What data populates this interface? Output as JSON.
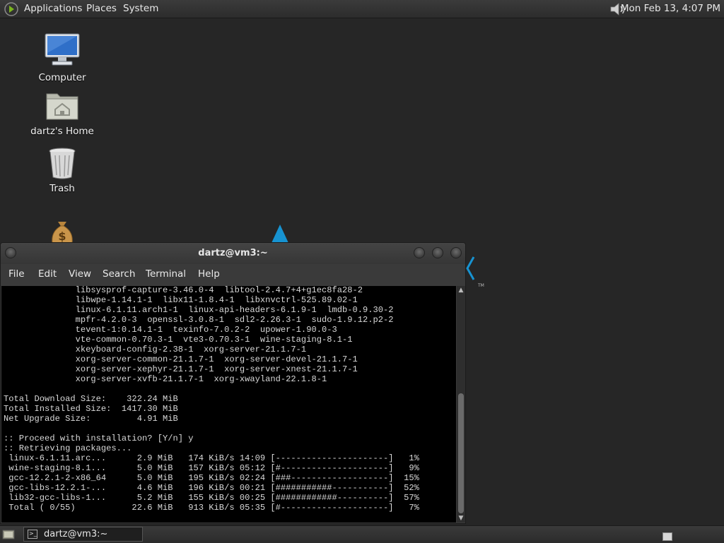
{
  "top_panel": {
    "menus": [
      "Applications",
      "Places",
      "System"
    ],
    "clock": "Mon Feb 13,  4:07 PM"
  },
  "desktop": {
    "icons": [
      {
        "label": "Computer",
        "icon": "computer-icon"
      },
      {
        "label": "dartz's Home",
        "icon": "home-folder-icon"
      },
      {
        "label": "Trash",
        "icon": "trash-icon"
      },
      {
        "label": "",
        "icon": "money-bag-icon"
      }
    ]
  },
  "terminal": {
    "title": "dartz@vm3:~",
    "menu": [
      "File",
      "Edit",
      "View",
      "Search",
      "Terminal",
      "Help"
    ],
    "lines": [
      "              libsysprof-capture-3.46.0-4  libtool-2.4.7+4+g1ec8fa28-2",
      "              libwpe-1.14.1-1  libx11-1.8.4-1  libxnvctrl-525.89.02-1",
      "              linux-6.1.11.arch1-1  linux-api-headers-6.1.9-1  lmdb-0.9.30-2",
      "              mpfr-4.2.0-3  openssl-3.0.8-1  sdl2-2.26.3-1  sudo-1.9.12.p2-2",
      "              tevent-1:0.14.1-1  texinfo-7.0.2-2  upower-1.90.0-3",
      "              vte-common-0.70.3-1  vte3-0.70.3-1  wine-staging-8.1-1",
      "              xkeyboard-config-2.38-1  xorg-server-21.1.7-1",
      "              xorg-server-common-21.1.7-1  xorg-server-devel-21.1.7-1",
      "              xorg-server-xephyr-21.1.7-1  xorg-server-xnest-21.1.7-1",
      "              xorg-server-xvfb-21.1.7-1  xorg-xwayland-22.1.8-1",
      "",
      "Total Download Size:    322.24 MiB",
      "Total Installed Size:  1417.30 MiB",
      "Net Upgrade Size:         4.91 MiB",
      "",
      ":: Proceed with installation? [Y/n] y",
      ":: Retrieving packages...",
      " linux-6.1.11.arc...      2.9 MiB   174 KiB/s 14:09 [----------------------]   1%",
      " wine-staging-8.1...      5.0 MiB   157 KiB/s 05:12 [#---------------------]   9%",
      " gcc-12.2.1-2-x86_64      5.0 MiB   195 KiB/s 02:24 [###-------------------]  15%",
      " gcc-libs-12.2.1-...      4.6 MiB   196 KiB/s 00:21 [###########-----------]  52%",
      " lib32-gcc-libs-1...      5.2 MiB   155 KiB/s 00:25 [############----------]  57%",
      " Total ( 0/55)           22.6 MiB   913 KiB/s 05:35 [#---------------------]   7%"
    ]
  },
  "taskbar": {
    "task_label": "dartz@vm3:~"
  }
}
